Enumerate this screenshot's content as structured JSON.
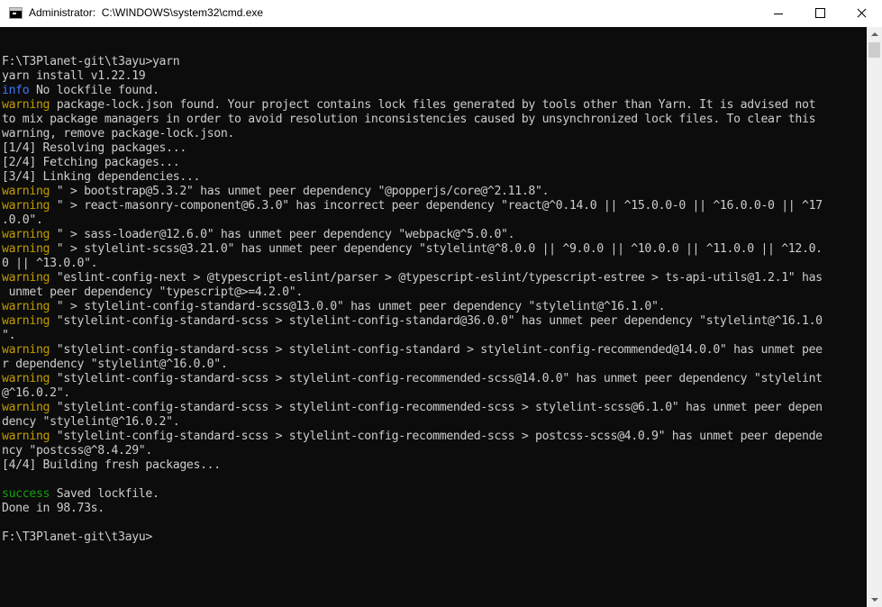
{
  "window": {
    "title": "Administrator:  C:\\WINDOWS\\system32\\cmd.exe",
    "icon": "console-icon",
    "controls": [
      "minimize",
      "maximize",
      "close"
    ]
  },
  "colors": {
    "background": "#0c0c0c",
    "text": "#cccccc",
    "warning": "#c19c00",
    "info": "#3b78ff",
    "success": "#13a10e"
  },
  "console": {
    "lines": [
      {
        "tag": "",
        "text": ""
      },
      {
        "tag": "",
        "text": "F:\\T3Planet-git\\t3ayu>yarn"
      },
      {
        "tag": "",
        "text": "yarn install v1.22.19"
      },
      {
        "tag": "info",
        "text": " No lockfile found."
      },
      {
        "tag": "warning",
        "text": " package-lock.json found. Your project contains lock files generated by tools other than Yarn. It is advised not"
      },
      {
        "tag": "",
        "text": "to mix package managers in order to avoid resolution inconsistencies caused by unsynchronized lock files. To clear this"
      },
      {
        "tag": "",
        "text": "warning, remove package-lock.json."
      },
      {
        "tag": "",
        "text": "[1/4] Resolving packages..."
      },
      {
        "tag": "",
        "text": "[2/4] Fetching packages..."
      },
      {
        "tag": "",
        "text": "[3/4] Linking dependencies..."
      },
      {
        "tag": "warning",
        "text": " \" > bootstrap@5.3.2\" has unmet peer dependency \"@popperjs/core@^2.11.8\"."
      },
      {
        "tag": "warning",
        "text": " \" > react-masonry-component@6.3.0\" has incorrect peer dependency \"react@^0.14.0 || ^15.0.0-0 || ^16.0.0-0 || ^17"
      },
      {
        "tag": "",
        "text": ".0.0\"."
      },
      {
        "tag": "warning",
        "text": " \" > sass-loader@12.6.0\" has unmet peer dependency \"webpack@^5.0.0\"."
      },
      {
        "tag": "warning",
        "text": " \" > stylelint-scss@3.21.0\" has unmet peer dependency \"stylelint@^8.0.0 || ^9.0.0 || ^10.0.0 || ^11.0.0 || ^12.0."
      },
      {
        "tag": "",
        "text": "0 || ^13.0.0\"."
      },
      {
        "tag": "warning",
        "text": " \"eslint-config-next > @typescript-eslint/parser > @typescript-eslint/typescript-estree > ts-api-utils@1.2.1\" has"
      },
      {
        "tag": "",
        "text": " unmet peer dependency \"typescript@>=4.2.0\"."
      },
      {
        "tag": "warning",
        "text": " \" > stylelint-config-standard-scss@13.0.0\" has unmet peer dependency \"stylelint@^16.1.0\"."
      },
      {
        "tag": "warning",
        "text": " \"stylelint-config-standard-scss > stylelint-config-standard@36.0.0\" has unmet peer dependency \"stylelint@^16.1.0"
      },
      {
        "tag": "",
        "text": "\"."
      },
      {
        "tag": "warning",
        "text": " \"stylelint-config-standard-scss > stylelint-config-standard > stylelint-config-recommended@14.0.0\" has unmet pee"
      },
      {
        "tag": "",
        "text": "r dependency \"stylelint@^16.0.0\"."
      },
      {
        "tag": "warning",
        "text": " \"stylelint-config-standard-scss > stylelint-config-recommended-scss@14.0.0\" has unmet peer dependency \"stylelint"
      },
      {
        "tag": "",
        "text": "@^16.0.2\"."
      },
      {
        "tag": "warning",
        "text": " \"stylelint-config-standard-scss > stylelint-config-recommended-scss > stylelint-scss@6.1.0\" has unmet peer depen"
      },
      {
        "tag": "",
        "text": "dency \"stylelint@^16.0.2\"."
      },
      {
        "tag": "warning",
        "text": " \"stylelint-config-standard-scss > stylelint-config-recommended-scss > postcss-scss@4.0.9\" has unmet peer depende"
      },
      {
        "tag": "",
        "text": "ncy \"postcss@^8.4.29\"."
      },
      {
        "tag": "",
        "text": "[4/4] Building fresh packages..."
      },
      {
        "tag": "",
        "text": ""
      },
      {
        "tag": "success",
        "text": " Saved lockfile."
      },
      {
        "tag": "",
        "text": "Done in 98.73s."
      },
      {
        "tag": "",
        "text": ""
      },
      {
        "tag": "",
        "text": "F:\\T3Planet-git\\t3ayu>"
      }
    ]
  }
}
